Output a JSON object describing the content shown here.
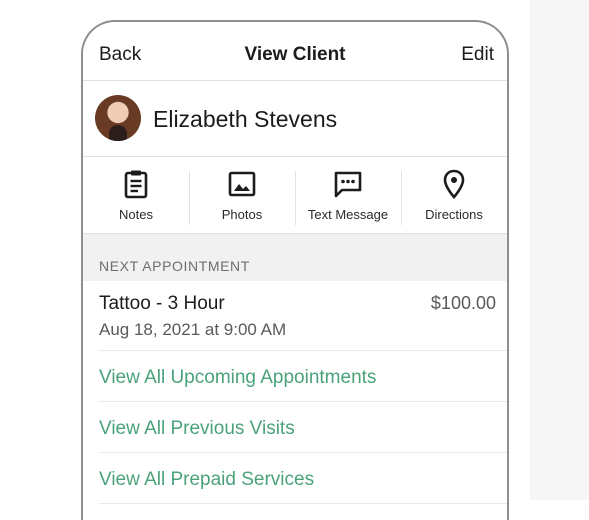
{
  "nav": {
    "back_label": "Back",
    "title": "View Client",
    "edit_label": "Edit"
  },
  "client": {
    "name": "Elizabeth Stevens"
  },
  "actions": [
    {
      "label": "Notes",
      "icon": "notes-icon"
    },
    {
      "label": "Photos",
      "icon": "image-icon"
    },
    {
      "label": "Text Message",
      "icon": "message-icon"
    },
    {
      "label": "Directions",
      "icon": "location-pin-icon"
    }
  ],
  "next_appointment": {
    "header": "NEXT APPOINTMENT",
    "service": "Tattoo - 3 Hour",
    "price": "$100.00",
    "datetime": "Aug 18, 2021 at 9:00 AM"
  },
  "links": [
    {
      "label": "View All Upcoming Appointments"
    },
    {
      "label": "View All Previous Visits"
    },
    {
      "label": "View All Prepaid Services"
    }
  ],
  "colors": {
    "link": "#4ba27a",
    "text": "#1c1c1c",
    "section_bg": "#f1f1f1"
  }
}
